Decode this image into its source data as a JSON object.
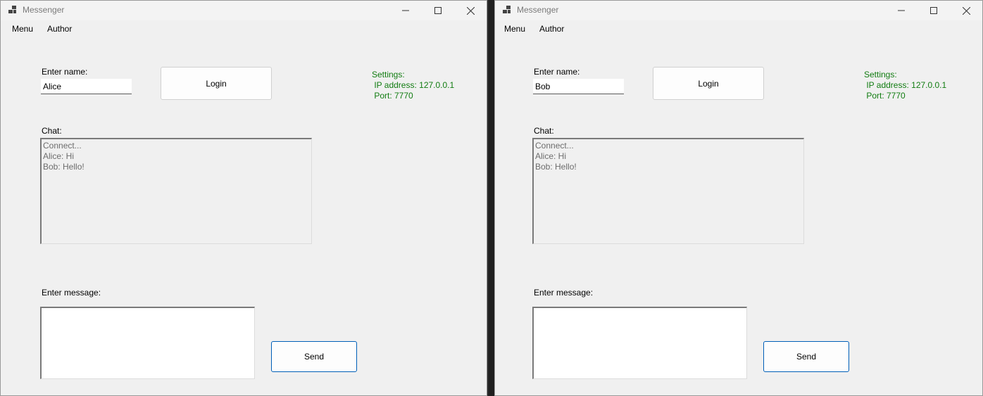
{
  "windows": [
    {
      "title": "Messenger",
      "menu": [
        "Menu",
        "Author"
      ],
      "name_label": "Enter name:",
      "name_value": "Alice",
      "login_label": "Login",
      "settings": {
        "heading": "Settings:",
        "ip": " IP address: 127.0.0.1",
        "port": " Port: 7770"
      },
      "chat_label": "Chat:",
      "chat_lines": [
        "Connect...",
        "Alice: Hi",
        "Bob: Hello!"
      ],
      "message_label": "Enter message:",
      "message_value": "",
      "send_label": "Send"
    },
    {
      "title": "Messenger",
      "menu": [
        "Menu",
        "Author"
      ],
      "name_label": "Enter name:",
      "name_value": "Bob",
      "login_label": "Login",
      "settings": {
        "heading": "Settings:",
        "ip": " IP address: 127.0.0.1",
        "port": " Port: 7770"
      },
      "chat_label": "Chat:",
      "chat_lines": [
        "Connect...",
        "Alice: Hi",
        "Bob: Hello!"
      ],
      "message_label": "Enter message:",
      "message_value": "",
      "send_label": "Send"
    }
  ],
  "colors": {
    "settings_text": "#117c11",
    "send_border": "#005fb8"
  },
  "icons": {
    "app": "app-window-icon",
    "minimize": "minimize-icon",
    "maximize": "maximize-icon",
    "close": "close-icon"
  }
}
